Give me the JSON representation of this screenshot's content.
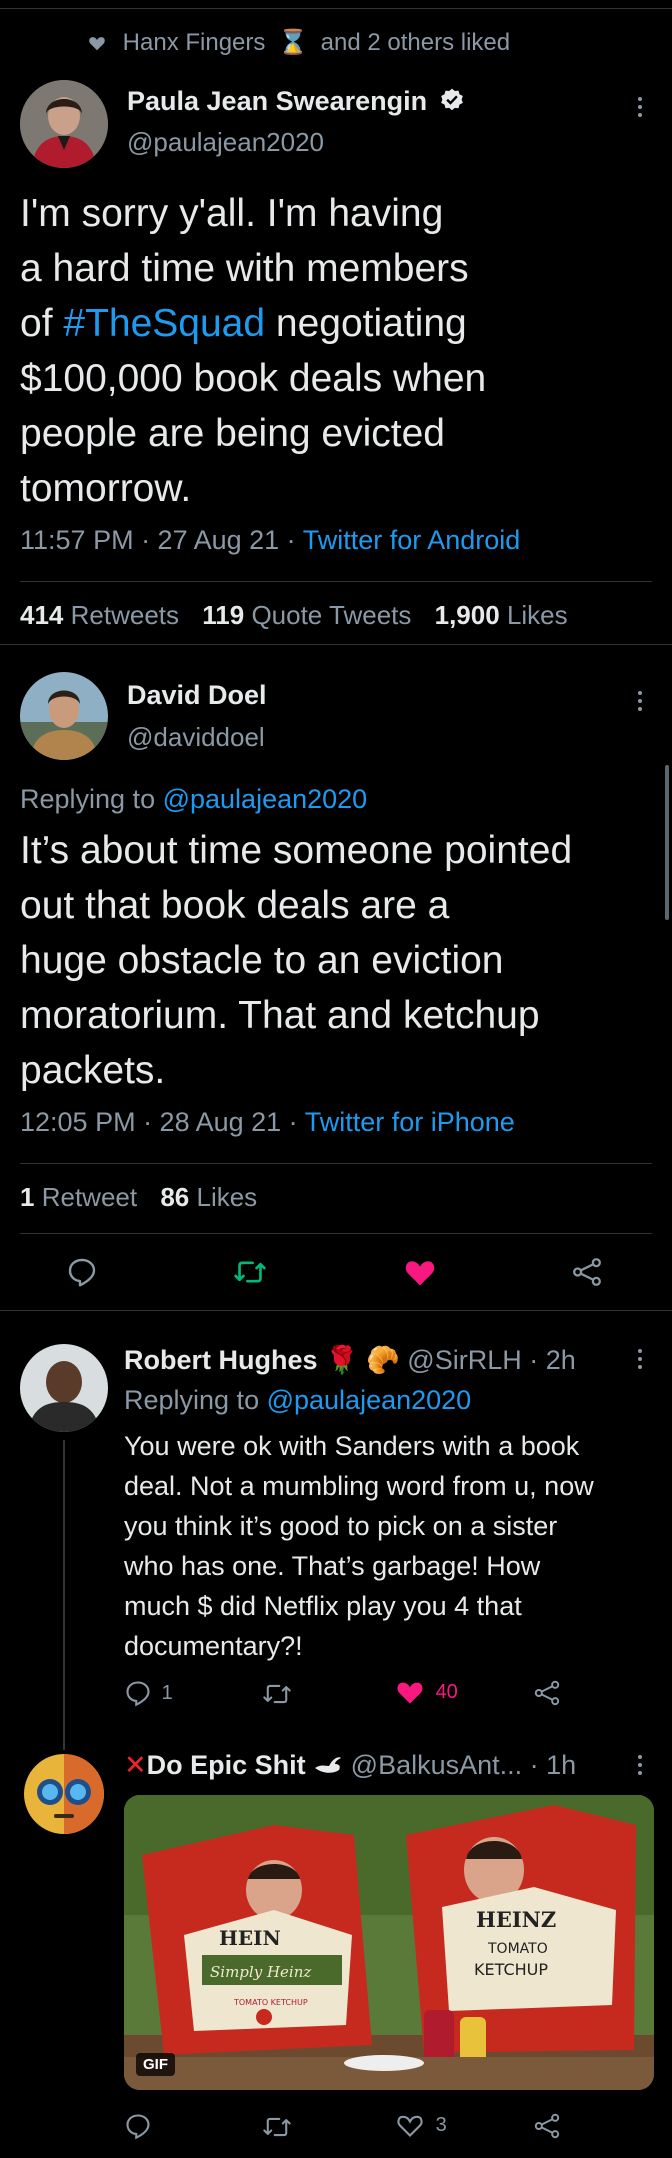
{
  "social_context": {
    "name": "Hanx Fingers",
    "emoji": "⌛",
    "suffix": "and 2 others liked"
  },
  "tweet1": {
    "author": "Paula Jean Swearengin",
    "handle": "@paulajean2020",
    "text_lines": [
      "I'm sorry y'all. I'm having",
      "a hard time with members",
      "of ",
      "#TheSquad",
      " negotiating",
      "$100,000 book deals when",
      "people are being evicted",
      "tomorrow."
    ],
    "time": "11:57 PM · 27 Aug 21 · ",
    "source": "Twitter for Android",
    "retweets": "414",
    "retweets_label": "Retweets",
    "quotes": "119",
    "quotes_label": "Quote Tweets",
    "likes": "1,900",
    "likes_label": "Likes"
  },
  "tweet2": {
    "author": "David Doel",
    "handle": "@daviddoel",
    "replying_prefix": "Replying to ",
    "replying_handle": "@paulajean2020",
    "text_lines": [
      "It’s about time someone pointed",
      "out that book deals are a",
      "huge obstacle to an eviction",
      "moratorium. That and ketchup",
      "packets."
    ],
    "time": "12:05 PM · 28 Aug 21 · ",
    "source": "Twitter for iPhone",
    "retweets": "1",
    "retweets_label": "Retweet",
    "likes": "86",
    "likes_label": "Likes"
  },
  "reply1": {
    "author": "Robert Hughes",
    "emojis": "🌹 🥐",
    "handle_time": "@SirRLH · 2h",
    "replying_prefix": "Replying to ",
    "replying_handle": "@paulajean2020",
    "text_lines": [
      "You were ok with Sanders with a book",
      "deal. Not a mumbling word from u, now",
      "you think it’s good to pick on a sister",
      "who has one. That’s garbage! How",
      "much $ did Netflix play you 4 that",
      "documentary?!"
    ],
    "reply_count": "1",
    "like_count": "40"
  },
  "reply2": {
    "author": "Do Epic Shit",
    "handle_time": "@BalkusAnt... · 1h",
    "gif_label": "GIF",
    "sign_left_brand": "HEIN",
    "sign_left_sub": "Simply Heinz",
    "sign_left_small": "TOMATO KETCHUP",
    "sign_right_brand": "HEINZ",
    "sign_right_sub1": "TOMATO",
    "sign_right_sub2": "KETCHUP",
    "like_count": "3"
  },
  "colors": {
    "accent": "#1d9bf0",
    "like": "#f91880",
    "retweet": "#00ba7c",
    "muted": "#8b98a5"
  }
}
